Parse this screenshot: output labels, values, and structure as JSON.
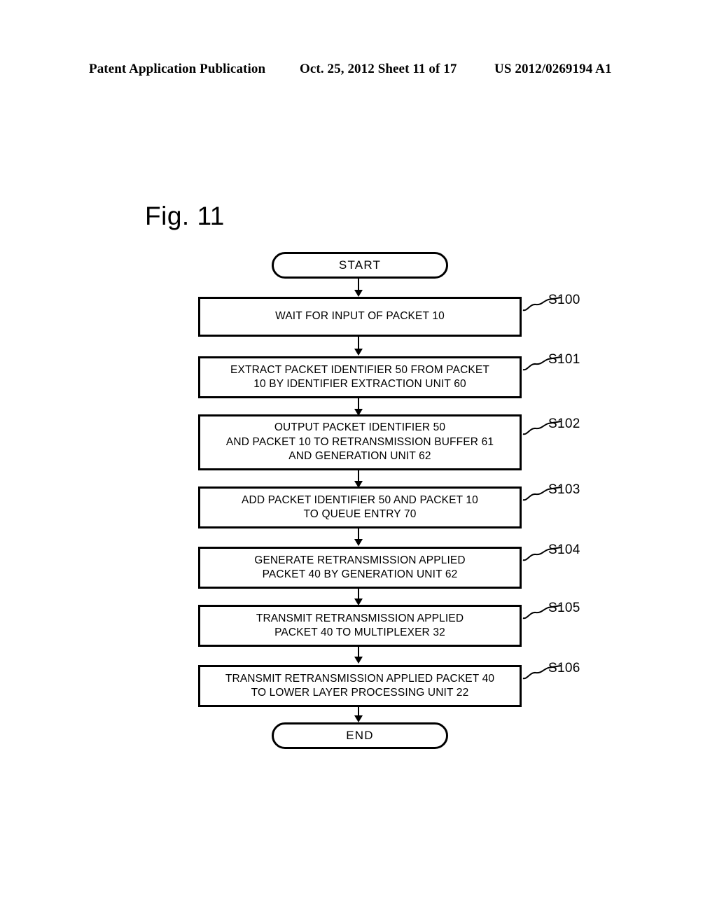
{
  "header": {
    "left": "Patent Application Publication",
    "middle": "Oct. 25, 2012  Sheet 11 of 17",
    "right": "US 2012/0269194 A1"
  },
  "figure": {
    "title": "Fig. 11"
  },
  "flowchart": {
    "type": "flowchart",
    "start_label": "START",
    "end_label": "END",
    "steps": [
      {
        "id": "S100",
        "ref": "S100",
        "lines": [
          "WAIT FOR INPUT OF PACKET 10"
        ]
      },
      {
        "id": "S101",
        "ref": "S101",
        "lines": [
          "EXTRACT PACKET IDENTIFIER 50 FROM PACKET",
          "10 BY IDENTIFIER EXTRACTION UNIT 60"
        ]
      },
      {
        "id": "S102",
        "ref": "S102",
        "lines": [
          "OUTPUT PACKET IDENTIFIER 50",
          "AND PACKET 10 TO RETRANSMISSION BUFFER 61",
          "AND GENERATION UNIT 62"
        ]
      },
      {
        "id": "S103",
        "ref": "S103",
        "lines": [
          "ADD PACKET IDENTIFIER 50 AND PACKET 10",
          "TO QUEUE ENTRY 70"
        ]
      },
      {
        "id": "S104",
        "ref": "S104",
        "lines": [
          "GENERATE RETRANSMISSION APPLIED",
          "PACKET 40 BY GENERATION UNIT 62"
        ]
      },
      {
        "id": "S105",
        "ref": "S105",
        "lines": [
          "TRANSMIT RETRANSMISSION APPLIED",
          "PACKET 40 TO MULTIPLEXER 32"
        ]
      },
      {
        "id": "S106",
        "ref": "S106",
        "lines": [
          "TRANSMIT RETRANSMISSION APPLIED PACKET 40",
          "TO LOWER LAYER PROCESSING UNIT 22"
        ]
      }
    ]
  },
  "colors": {
    "ink": "#000000",
    "paper": "#ffffff"
  }
}
